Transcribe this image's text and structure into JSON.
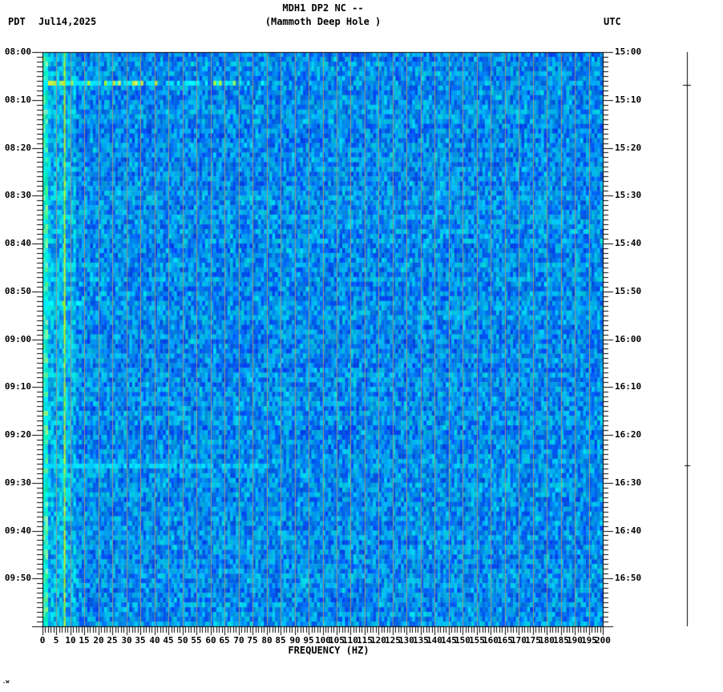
{
  "header": {
    "title": "MDH1 DP2 NC --",
    "subtitle": "(Mammoth Deep Hole )",
    "timezone_left": "PDT",
    "date": "Jul14,2025",
    "timezone_right": "UTC"
  },
  "axes": {
    "left_time_labels": [
      "08:00",
      "08:10",
      "08:20",
      "08:30",
      "08:40",
      "08:50",
      "09:00",
      "09:10",
      "09:20",
      "09:30",
      "09:40",
      "09:50"
    ],
    "right_time_labels": [
      "15:00",
      "15:10",
      "15:20",
      "15:30",
      "15:40",
      "15:50",
      "16:00",
      "16:10",
      "16:20",
      "16:30",
      "16:40",
      "16:50"
    ],
    "freq_tick_labels": [
      "0",
      "5",
      "10",
      "15",
      "20",
      "25",
      "30",
      "35",
      "40",
      "45",
      "50",
      "55",
      "60",
      "65",
      "70",
      "75",
      "80",
      "85",
      "90",
      "95",
      "100",
      "105",
      "110",
      "115",
      "120",
      "125",
      "130",
      "135",
      "140",
      "145",
      "150",
      "155",
      "160",
      "165",
      "170",
      "175",
      "180",
      "185",
      "190",
      "195",
      "200"
    ],
    "freq_axis_label": "FREQUENCY (HZ)"
  },
  "chart_data": {
    "type": "heatmap",
    "subtype": "seismic-spectrogram",
    "station": "MDH1 DP2 NC --",
    "station_name": "(Mammoth Deep Hole )",
    "date": "Jul14,2025",
    "x_axis": {
      "label": "FREQUENCY (HZ)",
      "min_hz": 0,
      "max_hz": 200,
      "major_tick_step_hz": 5,
      "minor_tick_step_hz": 1
    },
    "y_axis_left": {
      "timezone": "PDT",
      "start": "08:00",
      "end": "10:00",
      "label_step_min": 10,
      "minor_tick_step_min": 1
    },
    "y_axis_right": {
      "timezone": "UTC",
      "start": "15:00",
      "end": "17:00",
      "label_step_min": 10,
      "minor_tick_step_min": 1
    },
    "duration_minutes": 120,
    "background_character": "uniform blue broadband noise",
    "persistent_features": [
      {
        "name": "low-frequency-bright-band",
        "freq_range_hz": [
          0,
          1.5
        ]
      },
      {
        "name": "broad-low-freq-brightening",
        "freq_range_hz": [
          2,
          12
        ]
      },
      {
        "name": "narrowband-tonal-line",
        "freq_hz": 7.9
      }
    ],
    "events": [
      {
        "time_pdt": "08:07",
        "time_utc": "15:07",
        "minute": 6.4,
        "duration_min": 1.0,
        "max_freq_hz": 79,
        "intensity": "strong",
        "trace_mark": true
      },
      {
        "time_pdt": "08:52",
        "time_utc": "15:52",
        "minute": 51.6,
        "duration_min": 1.0,
        "max_freq_hz": 15,
        "intensity": "moderate",
        "trace_mark": false
      },
      {
        "time_pdt": "09:26",
        "time_utc": "16:26",
        "minute": 85.9,
        "duration_min": 1.0,
        "max_freq_hz": 85,
        "intensity": "mild",
        "trace_mark": true
      }
    ],
    "palette": {
      "base_blue": "#0073e6",
      "light_blue": "#2da9ff",
      "cyan_pop": "#00d2ff",
      "bright_green": "#3cf0a0",
      "tonal_line_yellow": "#c8e42c",
      "gridline_tan": "#aa967d",
      "axis_black": "#000000",
      "background_white": "#ffffff"
    }
  },
  "footer": {
    "artifact_text": ".w"
  }
}
